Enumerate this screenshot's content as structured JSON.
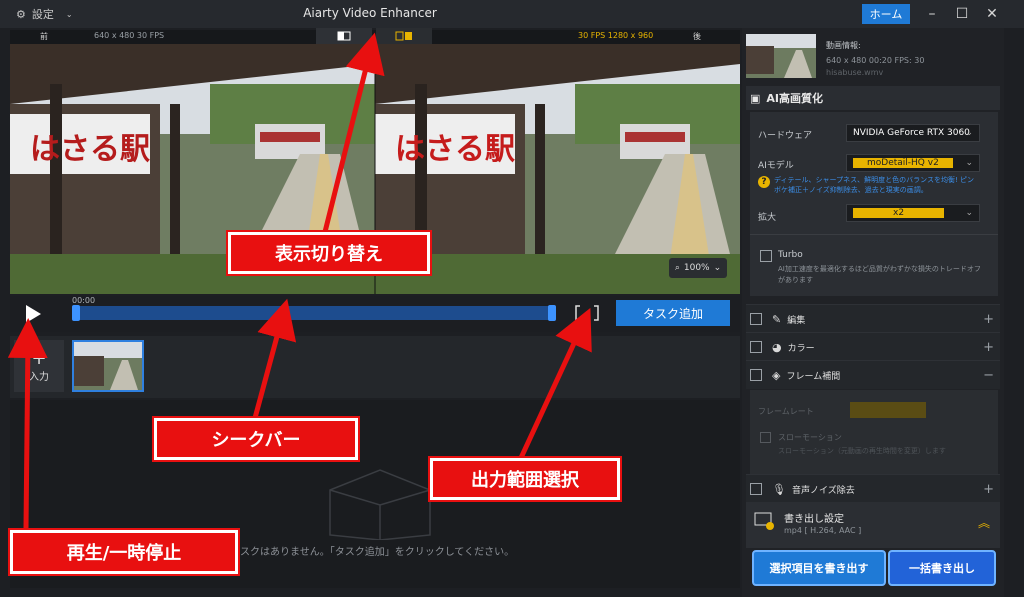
{
  "titlebar": {
    "settings_label": "設定",
    "app_title": "Aiarty Video Enhancer",
    "home_label": "ホーム"
  },
  "preview": {
    "before_label": "前",
    "before_info": "640 x 480  30 FPS",
    "after_info": "30 FPS  1280 x 960",
    "after_label": "後",
    "sign_text": "はさる駅",
    "zoom_level": "100%"
  },
  "controls": {
    "timecode": "00:00",
    "add_task_label": "タスク追加"
  },
  "thumbs": {
    "add_input_label": "入力"
  },
  "taskarea": {
    "empty_message": "タスクはありません。「タスク追加」をクリックしてください。"
  },
  "rpanel": {
    "info_title": "動画情報:",
    "info_specs": "640 x 480   00:20   FPS: 30",
    "info_file": "hisabuse.wmv",
    "ai_section_title": "AI高画質化",
    "hardware_label": "ハードウェア",
    "hardware_value": "NVIDIA GeForce RTX 3060",
    "model_label": "AIモデル",
    "model_value": "moDetail-HQ  v2",
    "model_hint": "ディテール、シャープネス、鮮明度と色のバランスを均衡! ピンボケ補正＋ノイズ抑制除去、過去と現実の画調。",
    "scale_label": "拡大",
    "scale_value": "x2",
    "turbo_label": "Turbo",
    "turbo_desc": "AI加工速度を最適化するほど品質がわずかな損失のトレードオフがあります",
    "edit_label": "編集",
    "color_label": "カラー",
    "frame_label": "フレーム補間",
    "frame_rate_label": "フレームレート",
    "slowmo_label": "スローモーション",
    "slowmo_desc": "スローモーション（元動画の再生時間を変更）します",
    "audio_label": "音声ノイズ除去",
    "export_title": "書き出し設定",
    "export_format": "mp4 [ H.264, AAC ]",
    "export_selected_label": "選択項目を書き出す",
    "export_all_label": "一括書き出し"
  },
  "annotations": {
    "view_toggle": "表示切り替え",
    "seekbar": "シークバー",
    "output_range": "出力範囲選択",
    "play_pause": "再生/一時停止"
  },
  "colors": {
    "accent": "#1f7ad6",
    "annotation_red": "#e81010",
    "highlight_yellow": "#e8b400"
  }
}
